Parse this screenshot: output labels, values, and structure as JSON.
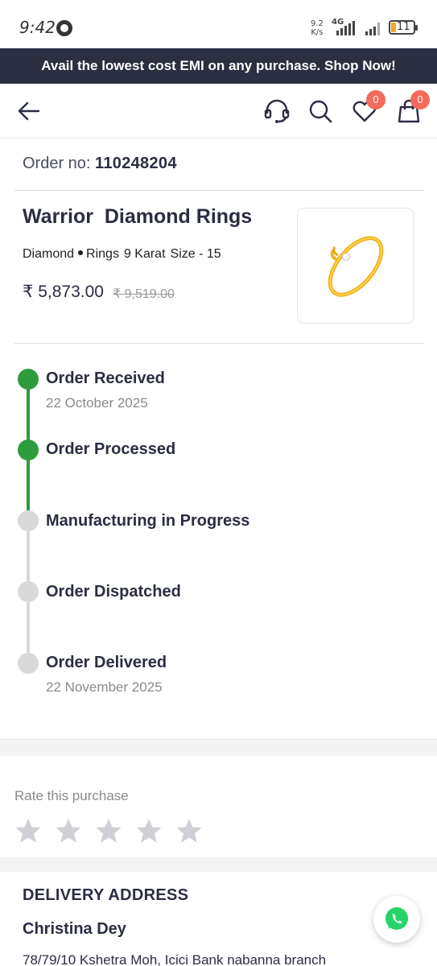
{
  "status_bar": {
    "time": "9:42",
    "speed_value": "9.2",
    "speed_unit": "K/s",
    "network": "4G",
    "battery": "11"
  },
  "promo": {
    "text": "Avail the lowest cost EMI on any purchase. Shop Now!"
  },
  "header": {
    "icons": [
      "back-arrow-icon",
      "headset-icon",
      "search-icon",
      "heart-icon",
      "bag-icon"
    ],
    "wishlist_count": "0",
    "cart_count": "0"
  },
  "order": {
    "label": "Order no:",
    "number": "110248204"
  },
  "product": {
    "title": "Warrior  Diamond Rings",
    "material": "Diamond",
    "category": "Rings",
    "karat": "9 Karat",
    "size": "Size - 15",
    "price": "₹ 5,873.00",
    "mrp": "₹ 9,519.00"
  },
  "timeline": {
    "steps": [
      {
        "label": "Order Received",
        "date": "22 October 2025",
        "done": true
      },
      {
        "label": "Order Processed",
        "date": "",
        "done": true
      },
      {
        "label": "Manufacturing in Progress",
        "date": "",
        "done": false
      },
      {
        "label": "Order Dispatched",
        "date": "",
        "done": false
      },
      {
        "label": "Order Delivered",
        "date": "22 November 2025",
        "done": false
      }
    ],
    "colors": {
      "done": "#2e9b3c",
      "pending": "#d9d9d9"
    }
  },
  "rating": {
    "label": "Rate this purchase",
    "stars_selected": 0,
    "stars_total": 5
  },
  "address": {
    "title": "DELIVERY ADDRESS",
    "name": "Christina Dey",
    "line1": "78/79/10 Kshetra Moh, Icici Bank nabanna branch"
  },
  "colors": {
    "accent": "#2b2f42",
    "badge": "#f26b5b",
    "whatsapp": "#25d366"
  }
}
